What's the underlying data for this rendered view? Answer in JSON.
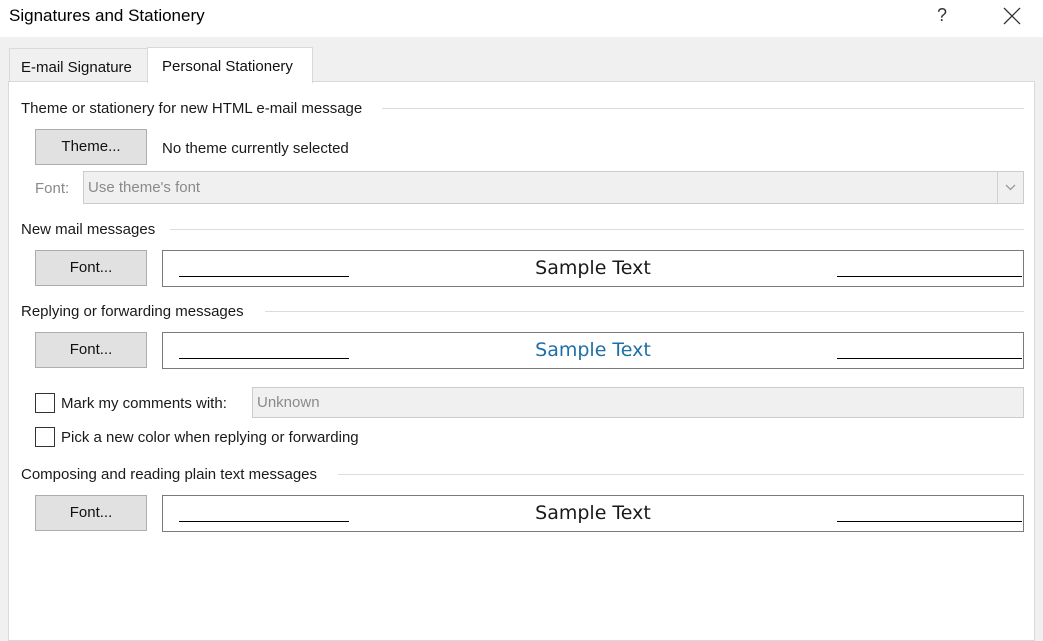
{
  "window": {
    "title": "Signatures and Stationery",
    "help_label": "?"
  },
  "tabs": [
    {
      "label": "E-mail Signature",
      "selected": false
    },
    {
      "label": "Personal Stationery",
      "selected": true
    }
  ],
  "theme_section": {
    "heading": "Theme or stationery for new HTML e-mail message",
    "theme_button": "Theme...",
    "theme_status": "No theme currently selected",
    "font_label": "Font:",
    "font_value": "Use theme's font"
  },
  "new_mail": {
    "heading": "New mail messages",
    "font_button": "Font...",
    "sample_text": "Sample Text",
    "sample_color": "#000000"
  },
  "reply": {
    "heading": "Replying or forwarding messages",
    "font_button": "Font...",
    "sample_text": "Sample Text",
    "sample_color": "#1e6fa8",
    "mark_comments_label": "Mark my comments with:",
    "mark_comments_checked": false,
    "mark_comments_value": "Unknown",
    "pick_color_label": "Pick a new color when replying or forwarding",
    "pick_color_checked": false
  },
  "plain_text": {
    "heading": "Composing and reading plain text messages",
    "font_button": "Font...",
    "sample_text": "Sample Text",
    "sample_color": "#000000"
  },
  "icons": {
    "close": "close-icon",
    "dropdown": "chevron-down-icon"
  }
}
